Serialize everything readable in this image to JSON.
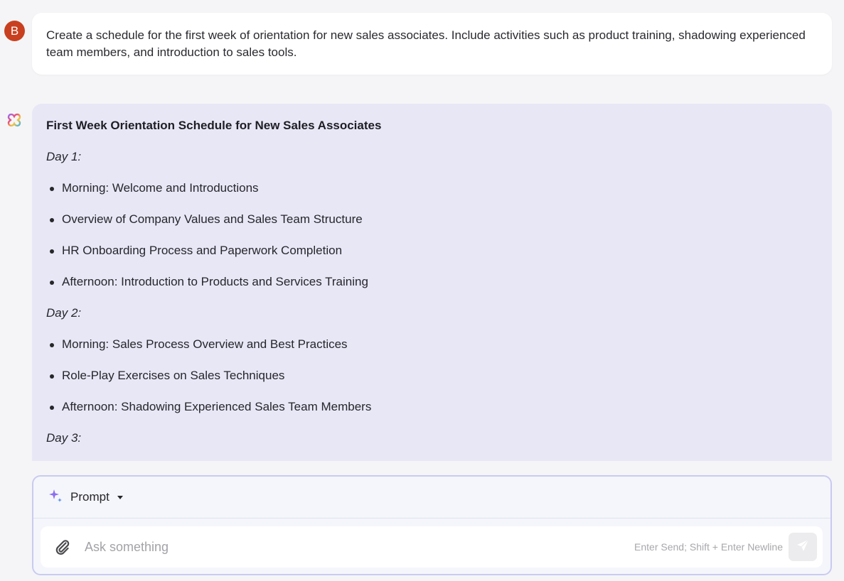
{
  "user_message": {
    "avatar_initial": "B",
    "avatar_color": "#c8401f",
    "text": "Create a schedule for the first week of orientation for new sales associates. Include activities such as product training, shadowing experienced team members, and introduction to sales tools."
  },
  "assistant_message": {
    "icon": "assistant-logo-icon",
    "title": "First Week Orientation Schedule for New Sales Associates",
    "days": [
      {
        "label": "Day 1:",
        "items": [
          "Morning: Welcome and Introductions",
          "Overview of Company Values and Sales Team Structure",
          "HR Onboarding Process and Paperwork Completion",
          "Afternoon: Introduction to Products and Services Training"
        ]
      },
      {
        "label": "Day 2:",
        "items": [
          "Morning: Sales Process Overview and Best Practices",
          "Role-Play Exercises on Sales Techniques",
          "Afternoon: Shadowing Experienced Sales Team Members"
        ]
      },
      {
        "label": "Day 3:",
        "items": []
      }
    ]
  },
  "composer": {
    "mode_label": "Prompt",
    "mode_icon": "sparkle-icon",
    "placeholder": "Ask something",
    "value": "",
    "hint": "Enter Send; Shift + Enter Newline",
    "attach_icon": "paperclip-icon",
    "send_icon": "send-icon"
  },
  "colors": {
    "assistant_bubble": "#e8e7f6",
    "composer_border": "#c9cbf0",
    "sparkle": "#8b6cf0"
  }
}
